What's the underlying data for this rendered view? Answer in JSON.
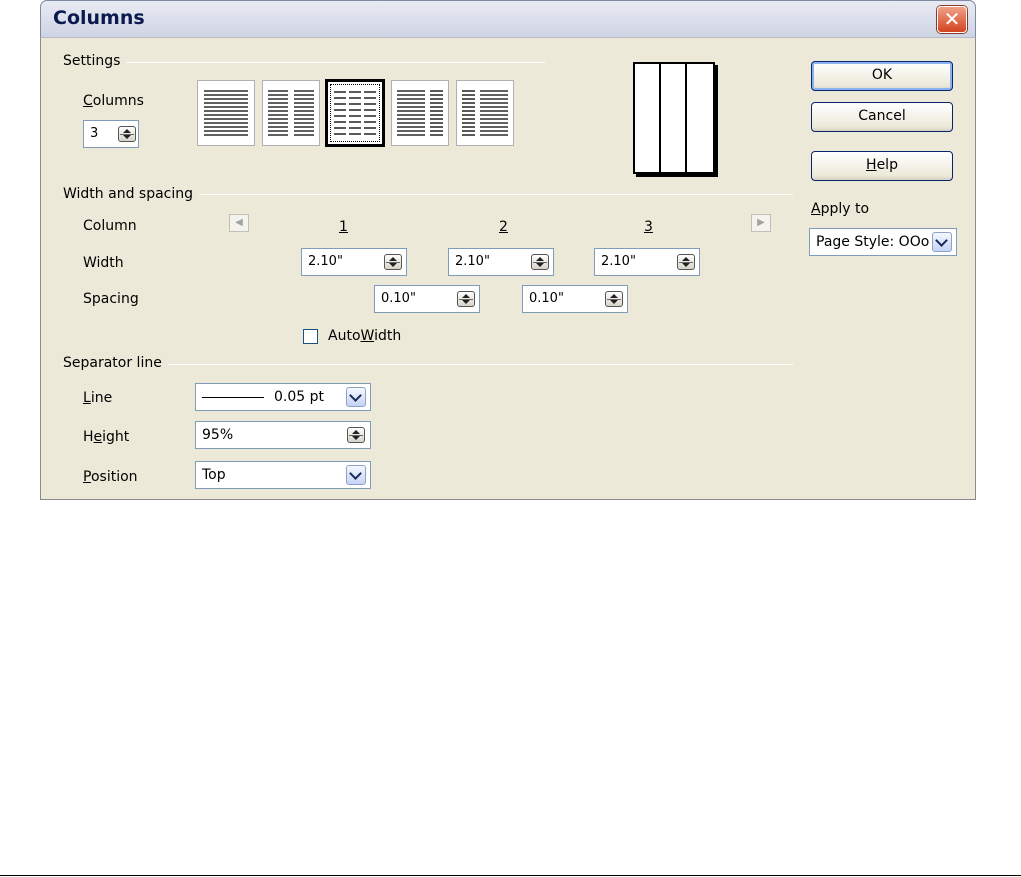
{
  "window": {
    "title": "Columns",
    "close_glyph": "✕"
  },
  "settings": {
    "group_label": "Settings",
    "columns_label": "Columns",
    "columns_mnemonic": "C",
    "columns_label_rest": "olumns",
    "columns_value": "3",
    "presets": [
      {
        "name": "one-column",
        "selected": false
      },
      {
        "name": "two-columns",
        "selected": false
      },
      {
        "name": "three-columns",
        "selected": true
      },
      {
        "name": "two-columns-left-wide",
        "selected": false
      },
      {
        "name": "two-columns-right-wide",
        "selected": false
      }
    ]
  },
  "width_spacing": {
    "group_label": "Width and spacing",
    "column_label": "Column",
    "width_label": "Width",
    "spacing_label": "Spacing",
    "column_numbers": [
      "1",
      "2",
      "3"
    ],
    "widths": [
      "2.10\"",
      "2.10\"",
      "2.10\""
    ],
    "spacings": [
      "0.10\"",
      "0.10\""
    ],
    "autowidth_prefix": "Auto",
    "autowidth_mnemonic": "W",
    "autowidth_rest": "idth",
    "autowidth_checked": false
  },
  "separator": {
    "group_label": "Separator line",
    "line_mnemonic": "L",
    "line_rest": "ine",
    "line_value": "0.05 pt",
    "height_prefix": "H",
    "height_mnemonic": "e",
    "height_rest": "ight",
    "height_value": "95%",
    "position_mnemonic": "P",
    "position_rest": "osition",
    "position_value": "Top"
  },
  "buttons": {
    "ok": "OK",
    "cancel": "Cancel",
    "help_mnemonic": "H",
    "help_rest": "elp"
  },
  "apply_to": {
    "mnemonic": "A",
    "rest": "pply to",
    "value": "Page Style: OOo"
  }
}
